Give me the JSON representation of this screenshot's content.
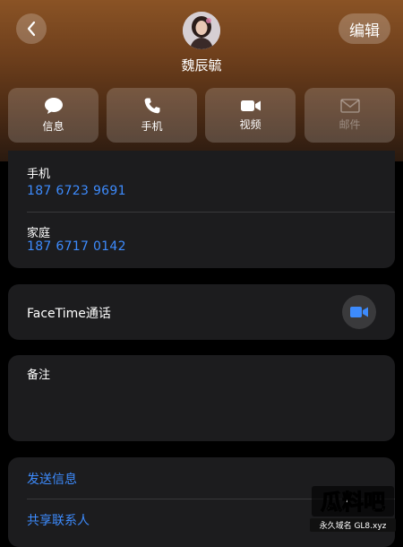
{
  "header": {
    "contact_name": "魏辰毓",
    "edit_label": "编辑",
    "back_icon": "chevron-left-icon"
  },
  "actions": [
    {
      "label": "信息",
      "icon": "message-icon",
      "enabled": true
    },
    {
      "label": "手机",
      "icon": "phone-icon",
      "enabled": true
    },
    {
      "label": "视频",
      "icon": "video-icon",
      "enabled": true
    },
    {
      "label": "邮件",
      "icon": "mail-icon",
      "enabled": false
    }
  ],
  "phones": [
    {
      "label": "手机",
      "number": "187 6723 9691"
    },
    {
      "label": "家庭",
      "number": "187 6717 0142"
    }
  ],
  "facetime": {
    "label": "FaceTime通话",
    "icon": "video-icon"
  },
  "notes": {
    "label": "备注"
  },
  "links": [
    {
      "label": "发送信息"
    },
    {
      "label": "共享联系人"
    }
  ],
  "watermark": {
    "line1": "瓜料吧",
    "line2": "永久域名 GL8.xyz"
  },
  "colors": {
    "link": "#3d8bfd",
    "card": "#1c1c1e",
    "header_top": "#8a5325"
  }
}
